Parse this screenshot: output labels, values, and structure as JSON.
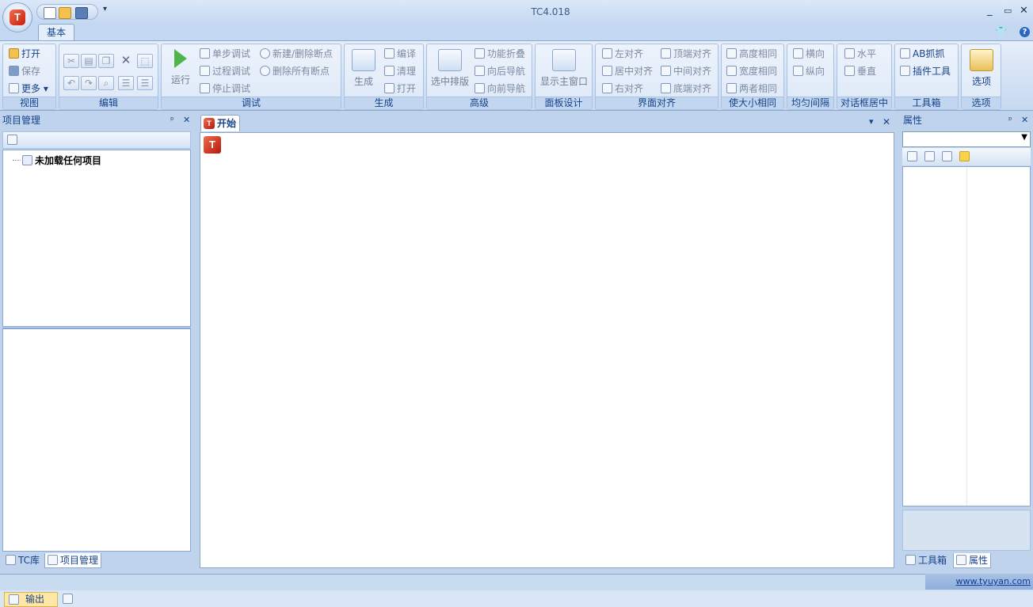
{
  "window": {
    "title": "TC4.018",
    "min": "_",
    "restore": "▭",
    "close": "✕"
  },
  "app_button": {
    "logo": "T"
  },
  "qat": {
    "more": "▾"
  },
  "ribbon": {
    "tabs": [
      {
        "label": "基本",
        "active": true
      }
    ],
    "right_icons": {
      "shirt": "👕",
      "help": "?"
    },
    "groups": {
      "view": {
        "caption": "视图",
        "items": [
          "打开",
          "保存",
          "更多"
        ]
      },
      "edit": {
        "caption": "编辑"
      },
      "debug": {
        "caption": "调试",
        "run": "运行",
        "items": [
          "单步调试",
          "过程调试",
          "停止调试",
          "新建/删除断点",
          "删除所有断点"
        ]
      },
      "build": {
        "caption": "生成",
        "big": "生成",
        "items": [
          "编译",
          "清理",
          "打开"
        ]
      },
      "advanced": {
        "caption": "高级",
        "big": "选中排版",
        "items": [
          "功能折叠",
          "向后导航",
          "向前导航"
        ]
      },
      "panel": {
        "caption": "面板设计",
        "big": "显示主窗口"
      },
      "align": {
        "caption": "界面对齐",
        "items": [
          "左对齐",
          "居中对齐",
          "右对齐",
          "顶端对齐",
          "中间对齐",
          "底端对齐"
        ]
      },
      "size": {
        "caption": "使大小相同",
        "items": [
          "高度相同",
          "宽度相同",
          "两者相同"
        ]
      },
      "spacing": {
        "caption": "均匀间隔",
        "items": [
          "横向",
          "纵向"
        ]
      },
      "center": {
        "caption": "对话框居中",
        "items": [
          "水平",
          "垂直"
        ]
      },
      "toolbox": {
        "caption": "工具箱",
        "items": [
          "AB抓抓",
          "插件工具"
        ]
      },
      "options": {
        "caption": "选项",
        "big": "选项"
      }
    }
  },
  "left_panel": {
    "title": "项目管理",
    "pin": "ᵖ",
    "close": "✕",
    "tree_root": "未加载任何项目",
    "tabs": [
      "TC库",
      "项目管理"
    ]
  },
  "doc": {
    "tab": "开始",
    "dropdown": "▾",
    "close": "✕"
  },
  "right_panel": {
    "title": "属性",
    "pin": "ᵖ",
    "close": "✕",
    "tabs": [
      "工具箱",
      "属性"
    ]
  },
  "status": {
    "url": "www.tyuyan.com"
  },
  "output": {
    "tab": "输出"
  }
}
